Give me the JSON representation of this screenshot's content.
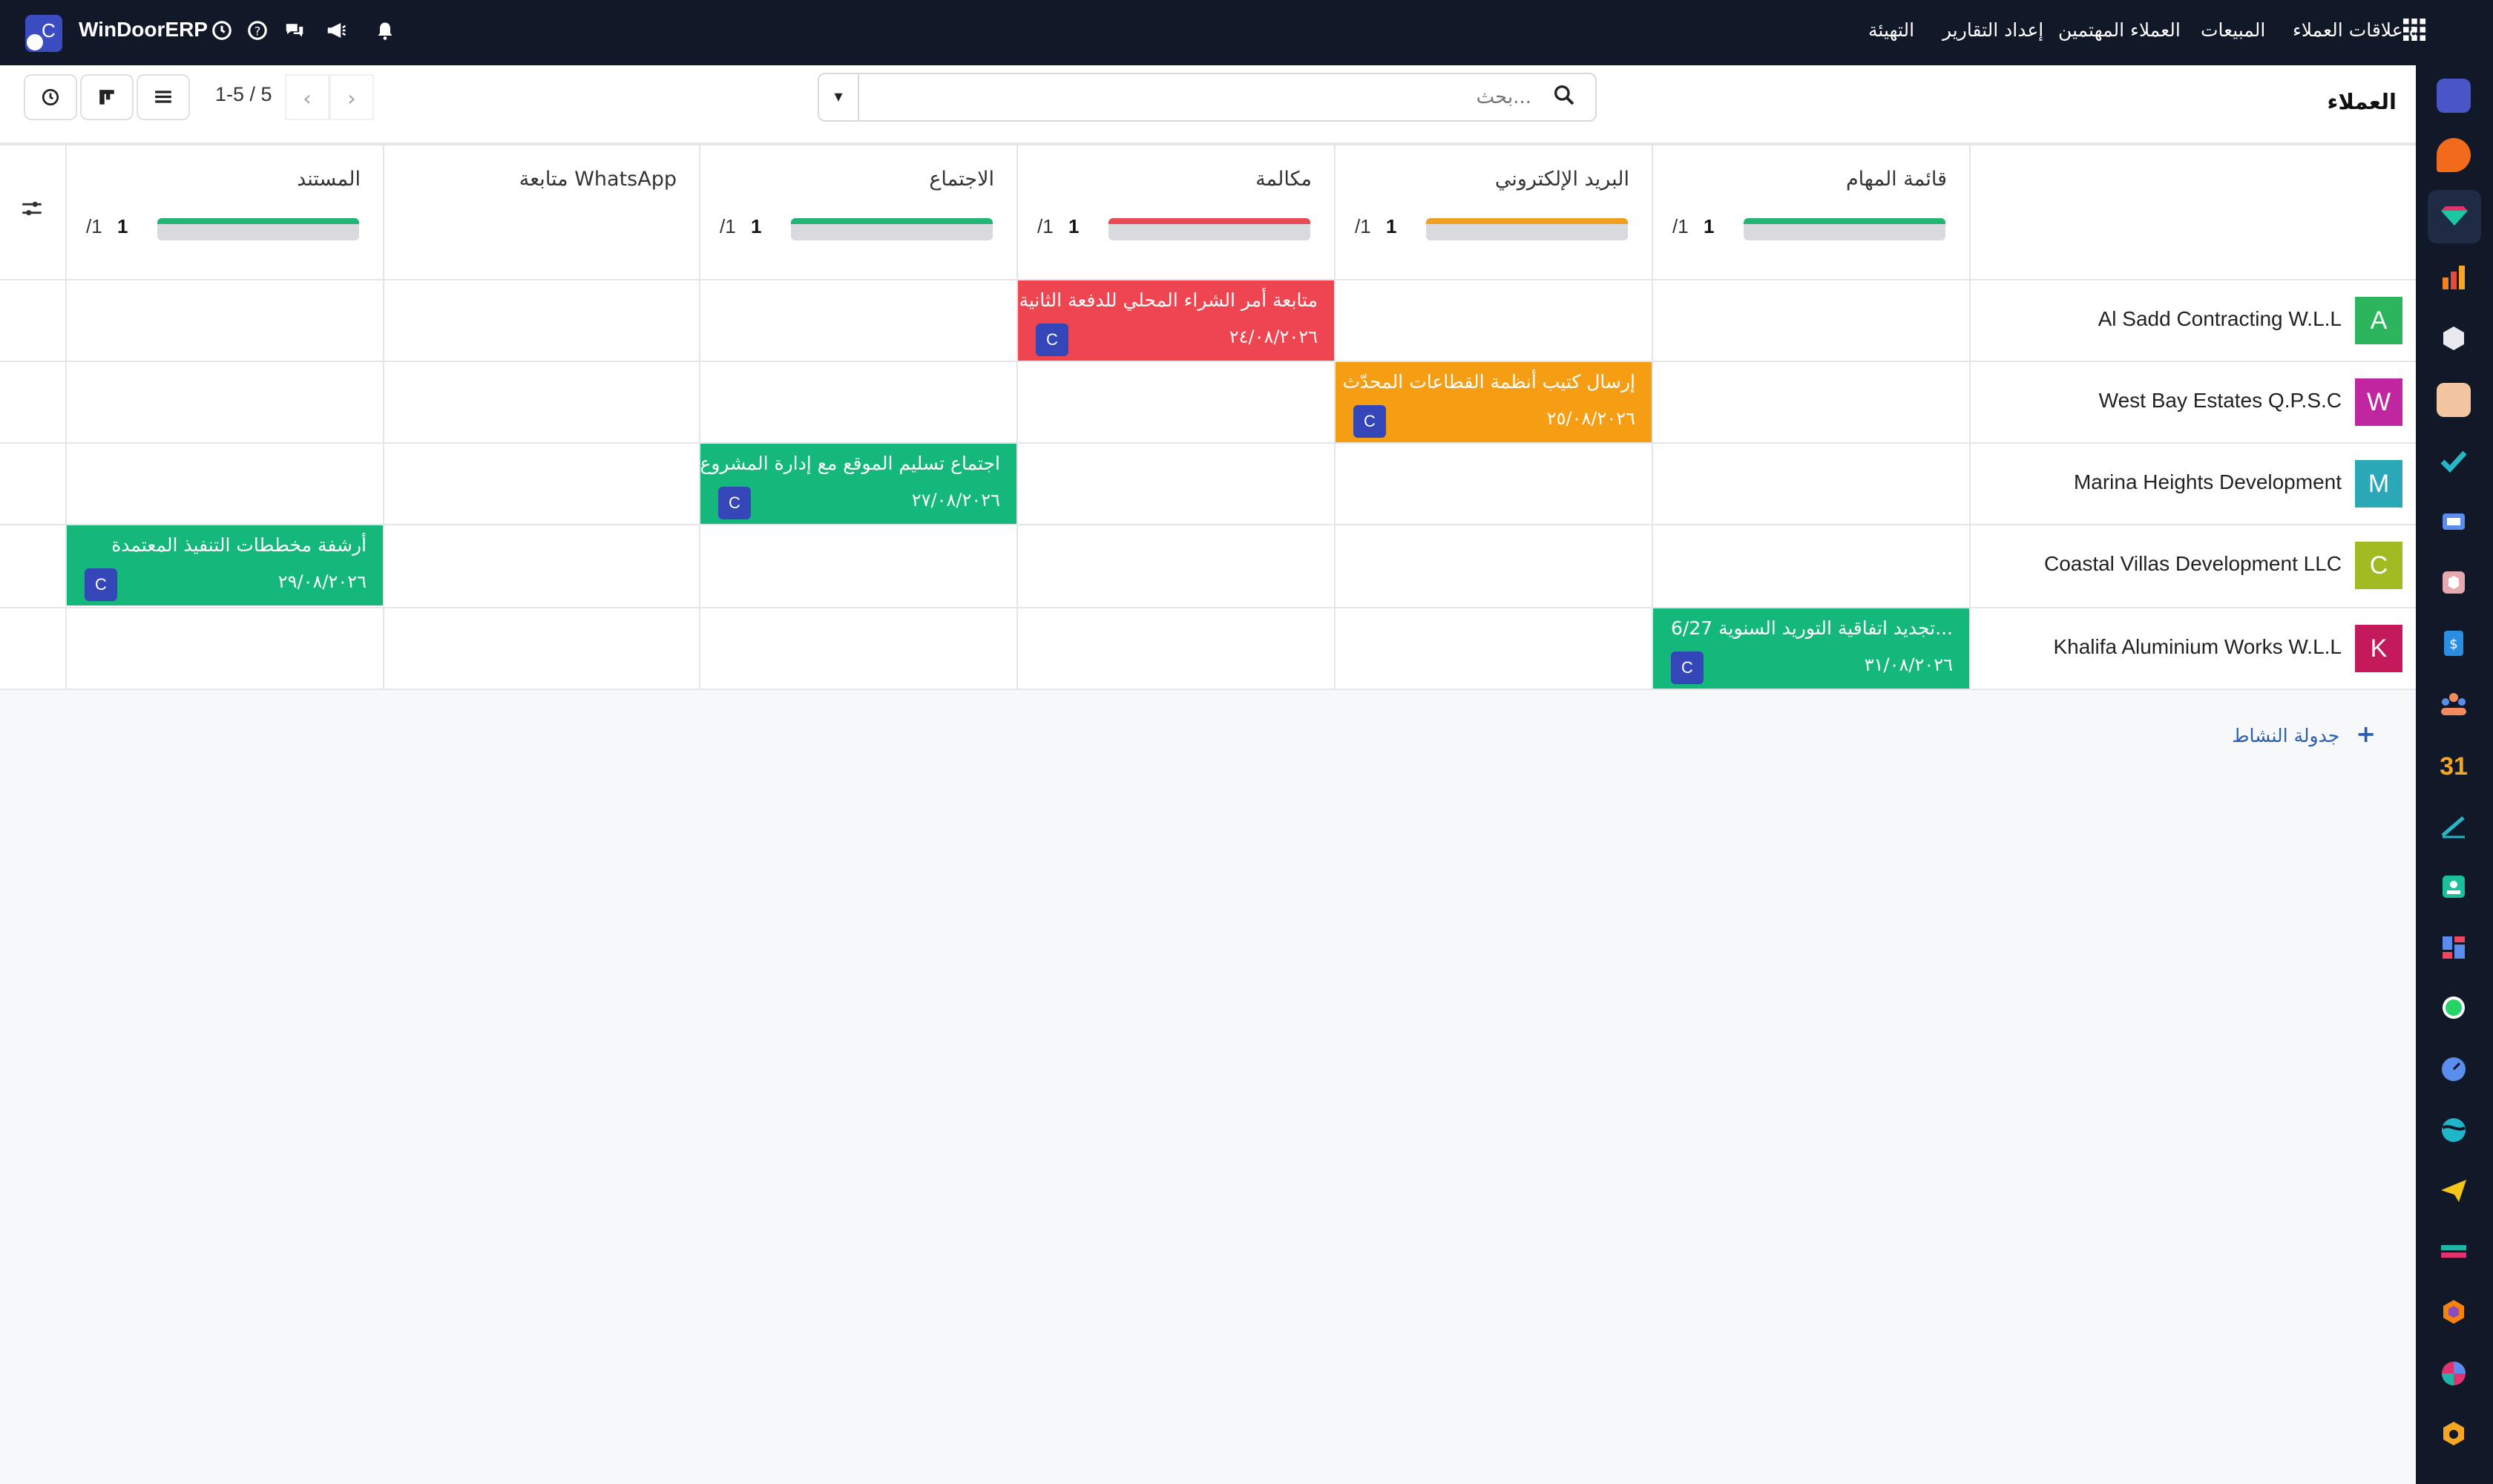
{
  "app": {
    "name": "WinDoorERP",
    "logo_letter": "C",
    "menu": [
      "إدارة علاقات العملاء",
      "المبيعات",
      "العملاء المهتمين",
      "إعداد التقارير",
      "التهيئة"
    ]
  },
  "control": {
    "page_title": "العملاء",
    "search_placeholder": "بحث...",
    "pager": "1-5 / 5"
  },
  "columns": [
    {
      "name": "قائمة المهام",
      "count": "1",
      "total": "/1",
      "color": "#22b573"
    },
    {
      "name": "البريد الإلكتروني",
      "count": "1",
      "total": "/1",
      "color": "#f0a020"
    },
    {
      "name": "مكالمة",
      "count": "1",
      "total": "/1",
      "color": "#e84a55"
    },
    {
      "name": "الاجتماع",
      "count": "1",
      "total": "/1",
      "color": "#22b573"
    },
    {
      "name": "متابعة WhatsApp",
      "count": "",
      "total": "",
      "color": ""
    },
    {
      "name": "المستند",
      "count": "1",
      "total": "/1",
      "color": "#22b573"
    }
  ],
  "rows": [
    {
      "name": "Al Sadd Contracting W.L.L",
      "letter": "A",
      "color": "#2db55d"
    },
    {
      "name": "West Bay Estates Q.P.S.C",
      "letter": "W",
      "color": "#c0269f"
    },
    {
      "name": "Marina Heights Development",
      "letter": "M",
      "color": "#2aa8b8"
    },
    {
      "name": "Coastal Villas Development LLC",
      "letter": "C",
      "color": "#a3bb22"
    },
    {
      "name": "Khalifa Aluminium Works W.L.L",
      "letter": "K",
      "color": "#c41a5b"
    }
  ],
  "activities": [
    {
      "title": "متابعة أمر الشراء المحلي للدفعة الثانية",
      "date": "٢٤/٠٨/٢٠٢٦",
      "avatar": "C",
      "color": "#ef4550"
    },
    {
      "title": "إرسال كتيب أنظمة القطاعات المحدّث",
      "date": "٢٥/٠٨/٢٠٢٦",
      "avatar": "C",
      "color": "#f59e14"
    },
    {
      "title": "اجتماع تسليم الموقع مع إدارة المشروع",
      "date": "٢٧/٠٨/٢٠٢٦",
      "avatar": "C",
      "color": "#14b87a"
    },
    {
      "title": "أرشفة مخططات التنفيذ المعتمدة",
      "date": "٢٩/٠٨/٢٠٢٦",
      "avatar": "C",
      "color": "#14b87a"
    },
    {
      "title": "تجديد اتفاقية التوريد السنوية 6/27...",
      "date": "٣١/٠٨/٢٠٢٦",
      "avatar": "C",
      "color": "#14b87a"
    }
  ],
  "footer": {
    "schedule": "جدولة النشاط"
  }
}
